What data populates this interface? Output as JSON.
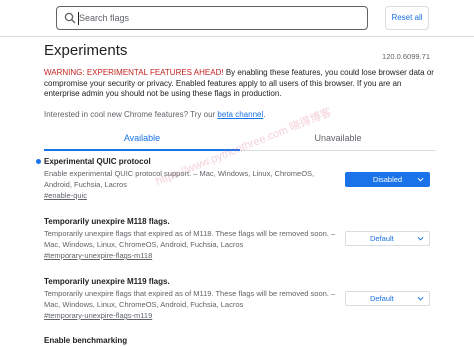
{
  "search": {
    "placeholder": "Search flags"
  },
  "reset_label": "Reset all",
  "title": "Experiments",
  "version": "120.0.6099.71",
  "warning": {
    "prefix": "WARNING: EXPERIMENTAL FEATURES AHEAD!",
    "body": " By enabling these features, you could lose browser data or compromise your security or privacy. Enabled features apply to all users of this browser. If you are an enterprise admin you should not be using these flags in production."
  },
  "interested": {
    "text": "Interested in cool new Chrome features? Try our ",
    "link": "beta channel",
    "suffix": "."
  },
  "tabs": [
    {
      "label": "Available"
    },
    {
      "label": "Unavailable"
    }
  ],
  "flags": [
    {
      "name": "Experimental QUIC protocol",
      "desc": "Enable experimental QUIC protocol support. – Mac, Windows, Linux, ChromeOS, Android, Fuchsia, Lacros",
      "link": "#enable-quic",
      "value": "Disabled"
    },
    {
      "name": "Temporarily unexpire M118 flags.",
      "desc": "Temporarily unexpire flags that expired as of M118. These flags will be removed soon. – Mac, Windows, Linux, ChromeOS, Android, Fuchsia, Lacros",
      "link": "#temporary-unexpire-flags-m118",
      "value": "Default"
    },
    {
      "name": "Temporarily unexpire M119 flags.",
      "desc": "Temporarily unexpire flags that expired as of M119. These flags will be removed soon. – Mac, Windows, Linux, ChromeOS, Android, Fuchsia, Lacros",
      "link": "#temporary-unexpire-flags-m119",
      "value": "Default"
    },
    {
      "name": "Enable benchmarking"
    }
  ],
  "watermark": "https://www.pythonthree.com 晓得博客",
  "colors": {
    "accent": "#1a73e8",
    "warning": "#c5221f",
    "text": "#202124",
    "muted": "#5f6368"
  },
  "icons": {
    "search": "search-icon",
    "dropdown": "chevron-down-icon",
    "modified": "modified-dot-icon"
  }
}
